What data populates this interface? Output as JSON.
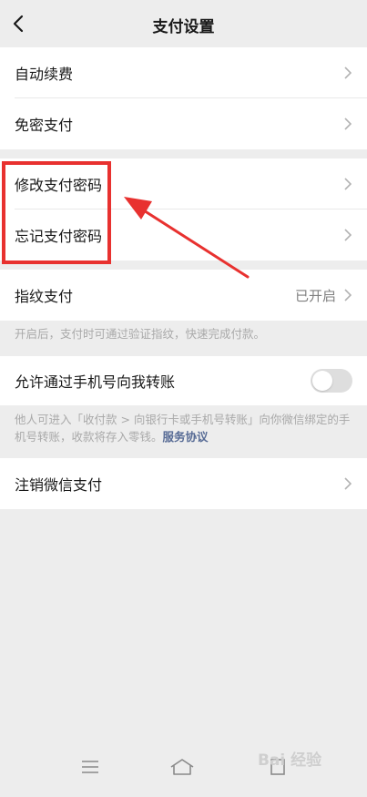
{
  "nav": {
    "title": "支付设置",
    "back_icon": "chevron-left-icon"
  },
  "group1": {
    "items": [
      {
        "label": "自动续费"
      },
      {
        "label": "免密支付"
      }
    ]
  },
  "group2": {
    "items": [
      {
        "label": "修改支付密码"
      },
      {
        "label": "忘记支付密码"
      }
    ]
  },
  "fingerprint": {
    "label": "指纹支付",
    "value": "已开启",
    "note": "开启后，支付时可通过验证指纹，快速完成付款。"
  },
  "transfer": {
    "label": "允许通过手机号向我转账",
    "toggle_on": false,
    "note": "他人可进入「收付款 > 向银行卡或手机号转账」向你微信绑定的手机号转账，收款将存入零钱。",
    "note_link": "服务协议"
  },
  "cancel": {
    "label": "注销微信支付"
  },
  "bottom_nav": {
    "icons": [
      "menu-icon",
      "home-icon",
      "back-icon"
    ]
  },
  "watermark": "Bai 经验",
  "colors": {
    "highlight": "#e8312f",
    "link": "#576b95",
    "background": "#ededed"
  }
}
